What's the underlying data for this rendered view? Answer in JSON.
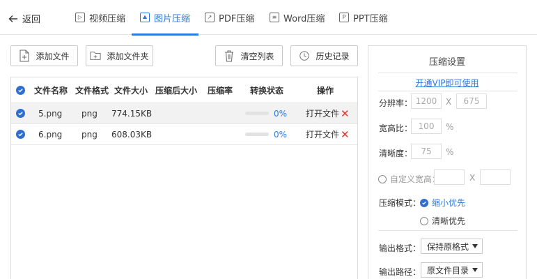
{
  "nav": {
    "back_label": "返回",
    "tabs": [
      {
        "label": "视频压缩",
        "icon": "video-file-icon"
      },
      {
        "label": "图片压缩",
        "icon": "image-file-icon"
      },
      {
        "label": "PDF压缩",
        "icon": "pdf-file-icon"
      },
      {
        "label": "Word压缩",
        "icon": "word-file-icon"
      },
      {
        "label": "PPT压缩",
        "icon": "ppt-file-icon"
      }
    ],
    "active_tab": "图片压缩"
  },
  "toolbar": {
    "add_file": "添加文件",
    "add_folder": "添加文件夹",
    "clear_list": "清空列表",
    "history": "历史记录"
  },
  "table": {
    "columns": [
      "文件名称",
      "文件格式",
      "文件大小",
      "压缩后大小",
      "压缩率",
      "转换状态",
      "操作"
    ],
    "rows": [
      {
        "name": "5.png",
        "format": "png",
        "size": "774.15KB",
        "compressed_size": "",
        "ratio": "",
        "progress": "0%",
        "action": "打开文件"
      },
      {
        "name": "6.png",
        "format": "png",
        "size": "608.03KB",
        "compressed_size": "",
        "ratio": "",
        "progress": "0%",
        "action": "打开文件"
      }
    ]
  },
  "settings": {
    "title": "压缩设置",
    "vip_link": "开通VIP即可使用",
    "resolution_label": "分辨率：",
    "resolution_width": "1200",
    "resolution_x": "X",
    "resolution_height": "675",
    "aspect_label": "宽高比：",
    "aspect_value": "100",
    "aspect_unit": "%",
    "clarity_label": "清晰度：",
    "clarity_value": "75",
    "clarity_unit": "%",
    "custom_label": "自定义宽高：",
    "custom_x": "X",
    "mode_label": "压缩模式：",
    "mode_options": [
      "缩小优先",
      "清晰优先"
    ],
    "mode_selected": "缩小优先",
    "output_format_label": "输出格式：",
    "output_format_value": "保持原格式",
    "output_path_label": "输出路径：",
    "output_path_value": "原文件目录"
  },
  "colors": {
    "accent": "#2f7ad9",
    "checkbox": "#2f6fd1",
    "delete": "#e0342e"
  }
}
